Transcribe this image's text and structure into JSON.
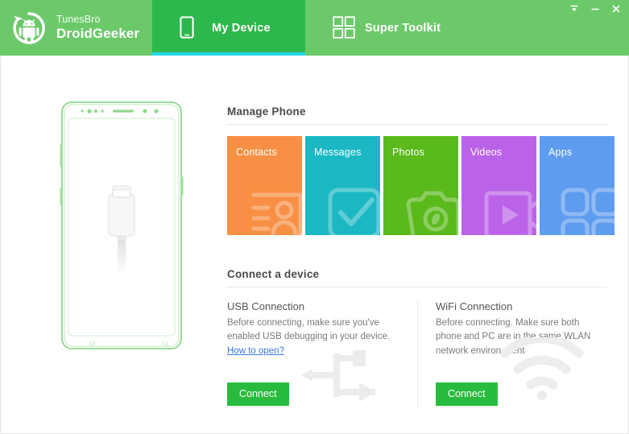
{
  "window": {
    "controls": [
      {
        "name": "menu",
        "glyph": "menu-icon"
      },
      {
        "name": "minimize",
        "glyph": "minimize-icon"
      },
      {
        "name": "close",
        "glyph": "close-icon"
      }
    ]
  },
  "header": {
    "brand": {
      "line1": "TunesBro",
      "line2": "DroidGeeker",
      "icon": "android-refresh-logo-icon"
    },
    "tabs": [
      {
        "label": "My Device",
        "icon": "phone-icon",
        "active": true
      },
      {
        "label": "Super Toolkit",
        "icon": "grid-2x2-icon",
        "active": false
      }
    ],
    "colors": {
      "bar": "#6cc96a",
      "active_tab": "#2db84c",
      "active_underline": "#29d7e8"
    }
  },
  "device_preview": {
    "icon": "phone-outline-with-usb-cable",
    "outline_color": "#8fd88c"
  },
  "main": {
    "manage": {
      "title": "Manage Phone",
      "tiles": [
        {
          "label": "Contacts",
          "color": "#f79045",
          "icon": "contact-card-icon"
        },
        {
          "label": "Messages",
          "color": "#1bb8c4",
          "icon": "check-message-icon"
        },
        {
          "label": "Photos",
          "color": "#5ab91b",
          "icon": "camera-icon"
        },
        {
          "label": "Videos",
          "color": "#bb63e8",
          "icon": "video-play-icon"
        },
        {
          "label": "Apps",
          "color": "#5e9cf0",
          "icon": "apps-grid-icon"
        }
      ]
    },
    "connect": {
      "title": "Connect a device",
      "usb": {
        "title": "USB Connection",
        "desc": "Before connecting, make sure you've enabled USB debugging in your device.",
        "link": "How to open?",
        "button": "Connect",
        "watermark_icon": "usb-icon"
      },
      "wifi": {
        "title": "WiFi Connection",
        "desc": "Before connecting. Make sure both phone and PC are in the same WLAN network environ-ment",
        "button": "Connect",
        "watermark_icon": "wifi-icon"
      },
      "button_color": "#28bc3f",
      "link_color": "#3c78d8"
    }
  }
}
